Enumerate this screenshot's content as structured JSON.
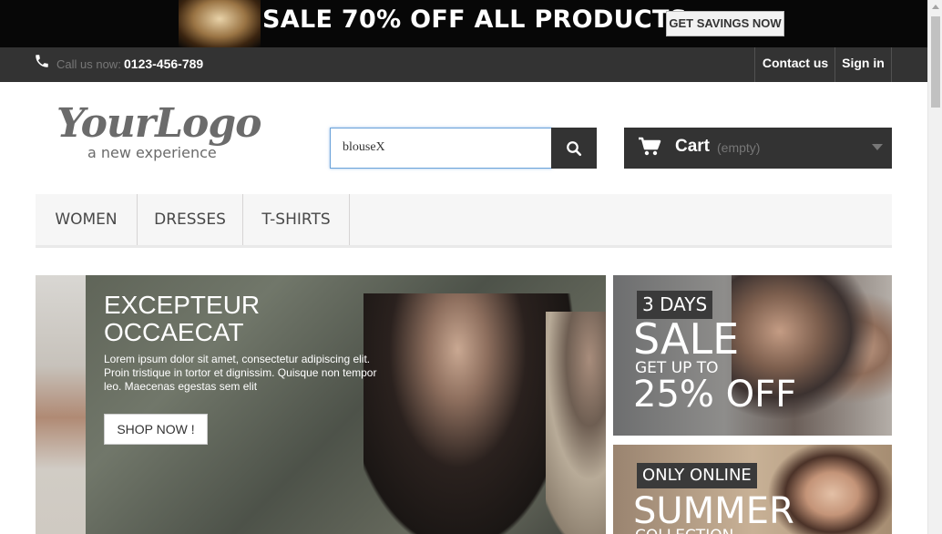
{
  "banner": {
    "headline": "SALE 70% OFF ALL PRODUCTS",
    "cta": "GET SAVINGS NOW"
  },
  "topnav": {
    "call_label": "Call us now:",
    "phone": "0123-456-789",
    "contact": "Contact us",
    "signin": "Sign in"
  },
  "logo": {
    "main": "YourLogo",
    "tagline": "a new experience"
  },
  "search": {
    "value": "blouseX",
    "placeholder": "Search"
  },
  "cart": {
    "label": "Cart",
    "status": "(empty)"
  },
  "menu": {
    "items": [
      "WOMEN",
      "DRESSES",
      "T-SHIRTS"
    ]
  },
  "hero": {
    "title": "EXCEPTEUR OCCAECAT",
    "text": "Lorem ipsum dolor sit amet, consectetur adipiscing elit. Proin tristique in tortor et dignissim. Quisque non tempor leo. Maecenas egestas sem elit",
    "button": "SHOP NOW !"
  },
  "promo_sale": {
    "badge": "3 DAYS",
    "word": "SALE",
    "sub": "GET UP TO",
    "pct": "25% OFF"
  },
  "promo_summer": {
    "badge": "ONLY ONLINE",
    "word": "SUMMER",
    "sub": "COLLECTION"
  }
}
